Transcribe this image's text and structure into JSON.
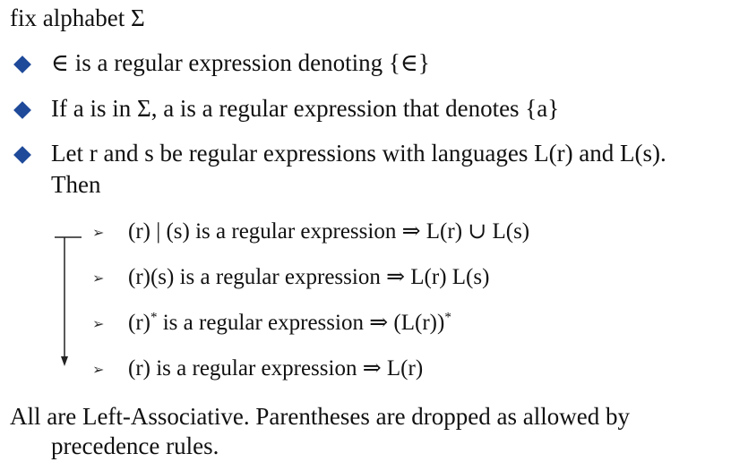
{
  "heading": "fix alphabet Σ",
  "bullets": [
    {
      "text": "∈ is a regular expression denoting {∈}"
    },
    {
      "text": "If  a is in  Σ, a is a regular expression that denotes {a}"
    },
    {
      "line1": "Let r and s be regular expressions with languages L(r) and L(s).",
      "line2": "Then"
    }
  ],
  "rules": [
    {
      "text": "(r) | (s) is a regular expression ⇒ L(r) ∪ L(s)"
    },
    {
      "text": "(r)(s) is a regular expression ⇒ L(r) L(s)"
    },
    {
      "pre": "(r)",
      "sup1": "*",
      "mid": " is a regular expression ⇒ (L(r))",
      "sup2": "*"
    },
    {
      "text": "(r) is a regular expression ⇒ L(r)"
    }
  ],
  "footer": {
    "line1": "All are Left-Associative. Parentheses are dropped as allowed by",
    "line2": "precedence rules."
  },
  "colors": {
    "bullet": "#1f4a9a",
    "text": "#111111"
  },
  "icons": {
    "bullet": "diamond",
    "rule_bullet": "arrowhead-right",
    "precedence_indicator": "down-arrow"
  }
}
